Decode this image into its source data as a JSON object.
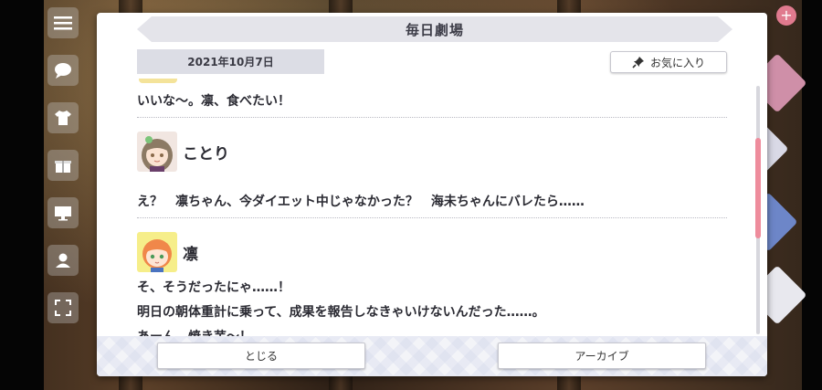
{
  "dialog": {
    "title": "毎日劇場",
    "date": "2021年10月7日",
    "favorite_label": "お気に入り",
    "favorite_icon": "pin-icon"
  },
  "messages": {
    "m1_text": "いいな〜。凛、食べたい！",
    "m2_speaker": "ことり",
    "m2_text": "え？　凛ちゃん、今ダイエット中じゃなかった？　海未ちゃんにバレたら……",
    "m3_speaker": "凛",
    "m3_line1": "そ、そうだったにゃ……！",
    "m3_line2": "明日の朝体重計に乗って、成果を報告しなきゃいけないんだった……。",
    "m3_line3": "あーん、焼き芋〜！"
  },
  "footer": {
    "close_label": "とじる",
    "archive_label": "アーカイブ"
  },
  "colors": {
    "scroll_thumb": "#ee8c9c",
    "title_bar": "#e4e4ea"
  }
}
